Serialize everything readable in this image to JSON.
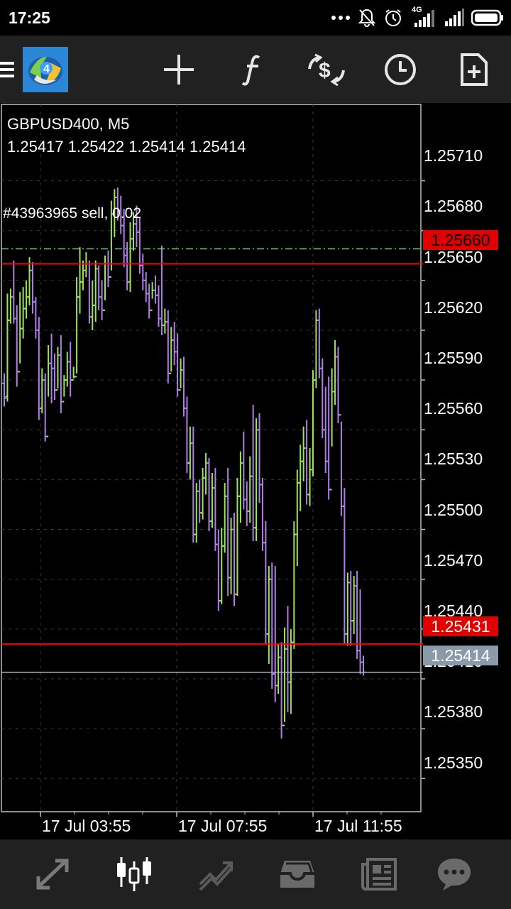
{
  "status_bar": {
    "time": "17:25",
    "network": "4G",
    "icons": [
      "more-dots-icon",
      "mute-bell-icon",
      "alarm-icon",
      "signal-4g-icon",
      "signal-icon",
      "battery-icon"
    ]
  },
  "toolbar": {
    "icons": [
      "menu-icon",
      "metatrader-logo",
      "crosshair-icon",
      "functions-icon",
      "trade-icon",
      "timeframe-clock-icon",
      "new-order-icon"
    ]
  },
  "chart": {
    "symbol_line": "GBPUSD400, M5",
    "ohlc_line": "1.25417 1.25422 1.25414 1.25414",
    "order_label": "#43963965 sell, 0.02",
    "price_axis": [
      "1.25710",
      "1.25680",
      "1.25650",
      "1.25620",
      "1.25590",
      "1.25560",
      "1.25530",
      "1.25500",
      "1.25470",
      "1.25440",
      "1.25410",
      "1.25380",
      "1.25350"
    ],
    "time_axis": [
      "17 Jul 03:55",
      "17 Jul 07:55",
      "17 Jul 11:55"
    ],
    "level_high": "1.25660",
    "level_low": "1.25431",
    "current_price": "1.25414",
    "order_price": 1.25669,
    "colors": {
      "up_bar": "#9ce35a",
      "down_bar": "#b07fe6",
      "level_line": "#ff0000",
      "level_tag": "#e00000",
      "current_tag": "#8a9aab",
      "order_line": "#6fd36f",
      "grid": "#3a3a3a"
    }
  },
  "chart_data": {
    "type": "ohlc",
    "title": "GBPUSD400, M5",
    "xlabel": "",
    "ylabel": "",
    "ylim": [
      1.2533,
      1.25756
    ],
    "x_ticks": [
      "17 Jul 03:55",
      "17 Jul 07:55",
      "17 Jul 11:55"
    ],
    "y_ticks": [
      1.2571,
      1.2568,
      1.2565,
      1.2562,
      1.2559,
      1.2556,
      1.2553,
      1.255,
      1.2547,
      1.2544,
      1.2541,
      1.2538,
      1.2535
    ],
    "horizontal_levels": [
      1.2566,
      1.25431,
      1.25414,
      1.25669
    ],
    "bars": [
      [
        1.25588,
        1.25594,
        1.25574,
        1.25579
      ],
      [
        1.2558,
        1.25642,
        1.25577,
        1.25626
      ],
      [
        1.25626,
        1.25645,
        1.25624,
        1.2564
      ],
      [
        1.2564,
        1.25662,
        1.25624,
        1.25627
      ],
      [
        1.25627,
        1.25635,
        1.25586,
        1.25595
      ],
      [
        1.25595,
        1.25643,
        1.256,
        1.25621
      ],
      [
        1.25621,
        1.25646,
        1.25615,
        1.25633
      ],
      [
        1.25633,
        1.2565,
        1.25627,
        1.2564
      ],
      [
        1.2564,
        1.25664,
        1.25635,
        1.25656
      ],
      [
        1.25656,
        1.25661,
        1.2563,
        1.25637
      ],
      [
        1.25637,
        1.2564,
        1.25615,
        1.2562
      ],
      [
        1.2562,
        1.25628,
        1.25566,
        1.25573
      ],
      [
        1.25573,
        1.25597,
        1.2557,
        1.2559
      ],
      [
        1.2559,
        1.25594,
        1.25553,
        1.25556
      ],
      [
        1.25556,
        1.25611,
        1.2558,
        1.256
      ],
      [
        1.256,
        1.25618,
        1.25576,
        1.25597
      ],
      [
        1.25597,
        1.25606,
        1.25578,
        1.25584
      ],
      [
        1.25584,
        1.2561,
        1.25585,
        1.25605
      ],
      [
        1.25605,
        1.25617,
        1.2557,
        1.25577
      ],
      [
        1.25577,
        1.25593,
        1.2558,
        1.2559
      ],
      [
        1.2559,
        1.25607,
        1.25586,
        1.25601
      ],
      [
        1.25601,
        1.25613,
        1.2558,
        1.2559
      ],
      [
        1.2559,
        1.25598,
        1.25591,
        1.25592
      ],
      [
        1.25592,
        1.25652,
        1.25594,
        1.2564
      ],
      [
        1.2564,
        1.2567,
        1.2563,
        1.25649
      ],
      [
        1.25649,
        1.25662,
        1.25644,
        1.25656
      ],
      [
        1.25656,
        1.25667,
        1.25652,
        1.2566
      ],
      [
        1.2566,
        1.25662,
        1.25624,
        1.25628
      ],
      [
        1.25628,
        1.2565,
        1.2562,
        1.25635
      ],
      [
        1.25635,
        1.25662,
        1.25625,
        1.25657
      ],
      [
        1.25657,
        1.25659,
        1.25632,
        1.2564
      ],
      [
        1.2564,
        1.2565,
        1.25626,
        1.25632
      ],
      [
        1.25632,
        1.25665,
        1.25638,
        1.2566
      ],
      [
        1.2566,
        1.25668,
        1.25646,
        1.25652
      ],
      [
        1.25652,
        1.25698,
        1.25656,
        1.2569
      ],
      [
        1.2569,
        1.25705,
        1.25676,
        1.257
      ],
      [
        1.257,
        1.25706,
        1.25686,
        1.25692
      ],
      [
        1.25692,
        1.25701,
        1.25678,
        1.25683
      ],
      [
        1.25683,
        1.25693,
        1.25658,
        1.25665
      ],
      [
        1.25665,
        1.25673,
        1.25644,
        1.25649
      ],
      [
        1.25649,
        1.25685,
        1.25643,
        1.25675
      ],
      [
        1.25675,
        1.25691,
        1.25668,
        1.25684
      ],
      [
        1.25684,
        1.25695,
        1.2567,
        1.25679
      ],
      [
        1.25679,
        1.25688,
        1.25654,
        1.25659
      ],
      [
        1.25659,
        1.25666,
        1.25644,
        1.2565
      ],
      [
        1.2565,
        1.25655,
        1.25637,
        1.25642
      ],
      [
        1.25642,
        1.25648,
        1.25627,
        1.25632
      ],
      [
        1.25632,
        1.25649,
        1.25639,
        1.25644
      ],
      [
        1.25644,
        1.25653,
        1.25636,
        1.25641
      ],
      [
        1.25641,
        1.25647,
        1.25622,
        1.25627
      ],
      [
        1.25627,
        1.25671,
        1.25617,
        1.25623
      ],
      [
        1.25623,
        1.25633,
        1.25618,
        1.25625
      ],
      [
        1.25625,
        1.25632,
        1.25588,
        1.25594
      ],
      [
        1.25594,
        1.25622,
        1.25595,
        1.25614
      ],
      [
        1.25614,
        1.25625,
        1.25599,
        1.25607
      ],
      [
        1.25607,
        1.25618,
        1.2558,
        1.25584
      ],
      [
        1.25584,
        1.25603,
        1.25585,
        1.25596
      ],
      [
        1.25596,
        1.25604,
        1.25568,
        1.25573
      ],
      [
        1.25573,
        1.2558,
        1.25534,
        1.2554
      ],
      [
        1.2554,
        1.25562,
        1.2553,
        1.25552
      ],
      [
        1.25552,
        1.25562,
        1.25492,
        1.25497
      ],
      [
        1.25497,
        1.25528,
        1.25492,
        1.25523
      ],
      [
        1.25523,
        1.2553,
        1.25504,
        1.2551
      ],
      [
        1.2551,
        1.25537,
        1.25506,
        1.25531
      ],
      [
        1.25531,
        1.25546,
        1.25521,
        1.2554
      ],
      [
        1.2554,
        1.25543,
        1.25499,
        1.25505
      ],
      [
        1.25505,
        1.25534,
        1.25501,
        1.25525
      ],
      [
        1.25525,
        1.25537,
        1.25487,
        1.25491
      ],
      [
        1.25491,
        1.255,
        1.25451,
        1.25457
      ],
      [
        1.25457,
        1.25501,
        1.25455,
        1.2549
      ],
      [
        1.2549,
        1.25528,
        1.25486,
        1.2552
      ],
      [
        1.2552,
        1.25537,
        1.2546,
        1.25471
      ],
      [
        1.25471,
        1.25507,
        1.25461,
        1.255
      ],
      [
        1.255,
        1.2551,
        1.25454,
        1.25461
      ],
      [
        1.25461,
        1.25531,
        1.2546,
        1.2552
      ],
      [
        1.2552,
        1.25547,
        1.25504,
        1.2554
      ],
      [
        1.2554,
        1.25559,
        1.25512,
        1.25518
      ],
      [
        1.25518,
        1.25529,
        1.25502,
        1.25511
      ],
      [
        1.25511,
        1.25544,
        1.25504,
        1.25532
      ],
      [
        1.25532,
        1.25575,
        1.25493,
        1.25501
      ],
      [
        1.25501,
        1.25567,
        1.25493,
        1.2556
      ],
      [
        1.2556,
        1.2557,
        1.25516,
        1.25527
      ],
      [
        1.25527,
        1.25531,
        1.25487,
        1.25492
      ],
      [
        1.25492,
        1.25505,
        1.25431,
        1.25437
      ],
      [
        1.25437,
        1.25478,
        1.25419,
        1.2547
      ],
      [
        1.2547,
        1.2548,
        1.25404,
        1.25413
      ],
      [
        1.25413,
        1.25478,
        1.25396,
        1.25406
      ],
      [
        1.25406,
        1.25431,
        1.25401,
        1.25423
      ],
      [
        1.25423,
        1.25432,
        1.25374,
        1.25382
      ],
      [
        1.25382,
        1.25441,
        1.25384,
        1.25428
      ],
      [
        1.25428,
        1.25454,
        1.2539,
        1.25408
      ],
      [
        1.25408,
        1.2544,
        1.25389,
        1.25432
      ],
      [
        1.25432,
        1.25505,
        1.25428,
        1.25497
      ],
      [
        1.25497,
        1.25536,
        1.25478,
        1.25528
      ],
      [
        1.25528,
        1.25551,
        1.25511,
        1.25541
      ],
      [
        1.25541,
        1.25562,
        1.25529,
        1.25549
      ],
      [
        1.25549,
        1.25566,
        1.25515,
        1.25521
      ],
      [
        1.25521,
        1.25549,
        1.25514,
        1.25536
      ],
      [
        1.25536,
        1.25596,
        1.25532,
        1.2559
      ],
      [
        1.2559,
        1.25632,
        1.25585,
        1.25626
      ],
      [
        1.25626,
        1.25633,
        1.25591,
        1.25597
      ],
      [
        1.25597,
        1.25603,
        1.25555,
        1.2556
      ],
      [
        1.2556,
        1.25586,
        1.25534,
        1.25541
      ],
      [
        1.25541,
        1.25592,
        1.25518,
        1.25524
      ],
      [
        1.25524,
        1.25597,
        1.2555,
        1.25583
      ],
      [
        1.25583,
        1.25614,
        1.25575,
        1.25604
      ],
      [
        1.25604,
        1.2561,
        1.25564,
        1.25569
      ],
      [
        1.25569,
        1.25565,
        1.25508,
        1.25514
      ],
      [
        1.25514,
        1.25525,
        1.25431,
        1.25437
      ],
      [
        1.25437,
        1.25474,
        1.2543,
        1.25468
      ],
      [
        1.25468,
        1.25475,
        1.2543,
        1.25445
      ],
      [
        1.25445,
        1.25472,
        1.25437,
        1.25466
      ],
      [
        1.25466,
        1.25475,
        1.25422,
        1.25427
      ],
      [
        1.25427,
        1.25464,
        1.25413,
        1.2542
      ],
      [
        1.2542,
        1.25424,
        1.25412,
        1.25414
      ]
    ]
  },
  "bottom_nav": {
    "items": [
      "quotes-icon",
      "chart-icon",
      "trade-icon",
      "history-icon",
      "news-icon",
      "chat-icon"
    ],
    "active": "chart-icon"
  }
}
